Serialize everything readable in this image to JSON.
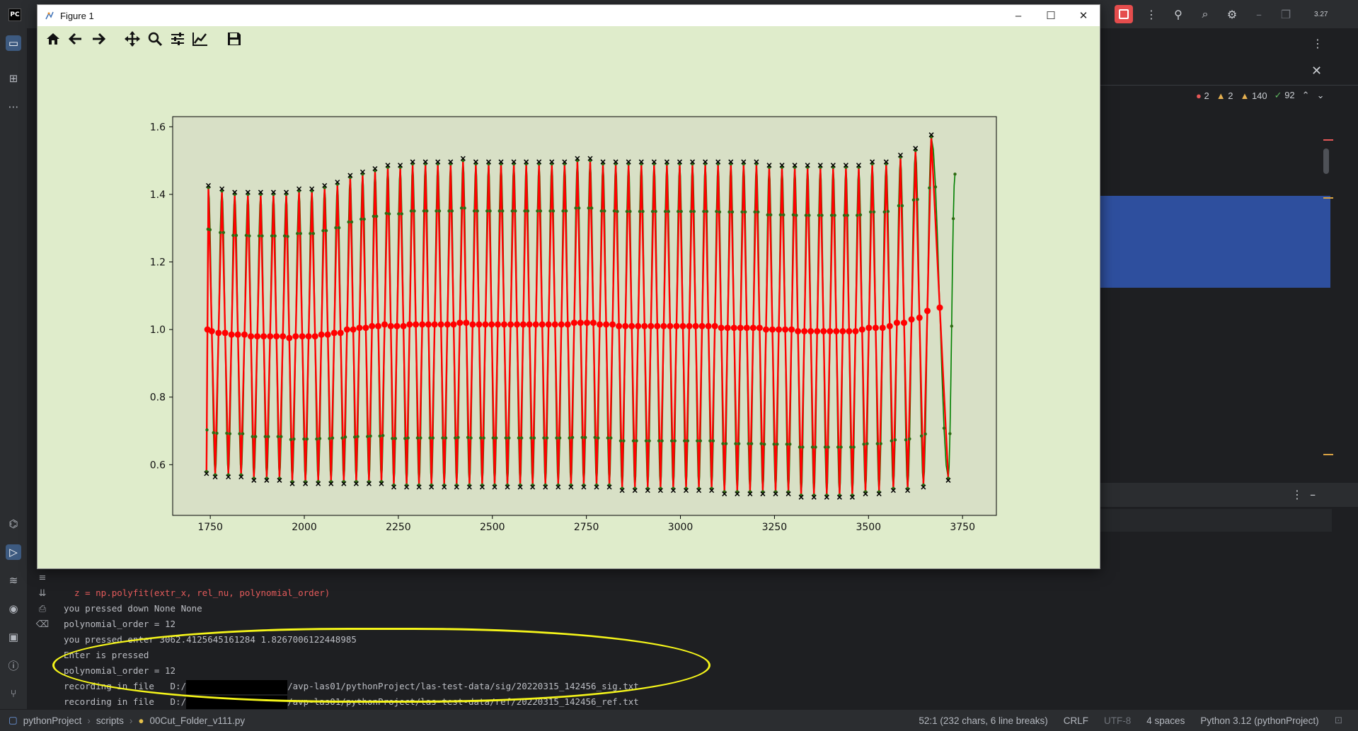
{
  "figure_window": {
    "title": "Figure 1",
    "toolbar": [
      "home-icon",
      "back-arrow-icon",
      "forward-arrow-icon",
      "pan-icon",
      "zoom-icon",
      "subplots-config-icon",
      "axes-edit-icon",
      "save-icon"
    ]
  },
  "ide": {
    "inspections": {
      "errors": "2",
      "warnings": "2",
      "weak_warnings": "140",
      "ok": "92"
    },
    "partial_label": "3.27"
  },
  "console": {
    "lines": [
      "  z = np.polyfit(extr_x, rel_nu, polynomial_order)",
      "you pressed down None None",
      "polynomial_order = 12",
      "you pressed enter 3062.4125645161284 1.8267006122448985",
      "Enter is pressed",
      "polynomial_order = 12"
    ],
    "rec1_prefix": "recording in file   D:/",
    "rec1_suffix": "/avp-las01/pythonProject/las-test-data/sig/20220315_142456_sig.txt",
    "rec2_prefix": "recording in file   D:/",
    "rec2_suffix": "/avp-las01/pythonProject/las-test-data/ref/20220315_142456_ref.txt"
  },
  "statusbar": {
    "project": "pythonProject",
    "folder": "scripts",
    "file": "00Cut_Folder_v111.py",
    "position": "52:1 (232 chars, 6 line breaks)",
    "line_sep": "CRLF",
    "encoding": "UTF-8",
    "indent": "4 spaces",
    "interpreter": "Python 3.12 (pythonProject)"
  },
  "chart_data": {
    "type": "line",
    "xlim": [
      1650,
      3840
    ],
    "ylim": [
      0.45,
      1.63
    ],
    "xticks": [
      1750,
      2000,
      2250,
      2500,
      2750,
      3000,
      3250,
      3500,
      3750
    ],
    "yticks": [
      0.6,
      0.8,
      1.0,
      1.2,
      1.4,
      1.6
    ],
    "grid": false,
    "colors": {
      "signal": "#008000",
      "fit": "#ff0000",
      "midpoint": "#ff0000",
      "extrema": "#000000"
    },
    "peaks": [
      [
        1745,
        1.42
      ],
      [
        1781,
        1.41
      ],
      [
        1815,
        1.4
      ],
      [
        1850,
        1.4
      ],
      [
        1884,
        1.4
      ],
      [
        1918,
        1.4
      ],
      [
        1952,
        1.4
      ],
      [
        1986,
        1.41
      ],
      [
        2020,
        1.41
      ],
      [
        2054,
        1.42
      ],
      [
        2088,
        1.43
      ],
      [
        2122,
        1.45
      ],
      [
        2155,
        1.46
      ],
      [
        2188,
        1.47
      ],
      [
        2222,
        1.48
      ],
      [
        2255,
        1.48
      ],
      [
        2288,
        1.49
      ],
      [
        2322,
        1.49
      ],
      [
        2355,
        1.49
      ],
      [
        2389,
        1.49
      ],
      [
        2422,
        1.5
      ],
      [
        2456,
        1.49
      ],
      [
        2490,
        1.49
      ],
      [
        2523,
        1.49
      ],
      [
        2557,
        1.49
      ],
      [
        2590,
        1.49
      ],
      [
        2624,
        1.49
      ],
      [
        2658,
        1.49
      ],
      [
        2692,
        1.49
      ],
      [
        2726,
        1.5
      ],
      [
        2760,
        1.5
      ],
      [
        2794,
        1.49
      ],
      [
        2828,
        1.49
      ],
      [
        2862,
        1.49
      ],
      [
        2896,
        1.49
      ],
      [
        2930,
        1.49
      ],
      [
        2964,
        1.49
      ],
      [
        2998,
        1.49
      ],
      [
        3032,
        1.49
      ],
      [
        3066,
        1.49
      ],
      [
        3100,
        1.49
      ],
      [
        3134,
        1.49
      ],
      [
        3168,
        1.49
      ],
      [
        3202,
        1.49
      ],
      [
        3236,
        1.48
      ],
      [
        3270,
        1.48
      ],
      [
        3304,
        1.48
      ],
      [
        3338,
        1.48
      ],
      [
        3372,
        1.48
      ],
      [
        3406,
        1.48
      ],
      [
        3440,
        1.48
      ],
      [
        3474,
        1.48
      ],
      [
        3510,
        1.49
      ],
      [
        3547,
        1.49
      ],
      [
        3585,
        1.51
      ],
      [
        3625,
        1.53
      ],
      [
        3667,
        1.57
      ]
    ],
    "troughs": [
      [
        1740,
        0.58
      ],
      [
        1763,
        0.57
      ],
      [
        1798,
        0.57
      ],
      [
        1832,
        0.57
      ],
      [
        1866,
        0.56
      ],
      [
        1900,
        0.56
      ],
      [
        1934,
        0.56
      ],
      [
        1968,
        0.55
      ],
      [
        2003,
        0.55
      ],
      [
        2037,
        0.55
      ],
      [
        2071,
        0.55
      ],
      [
        2105,
        0.55
      ],
      [
        2138,
        0.55
      ],
      [
        2172,
        0.55
      ],
      [
        2205,
        0.55
      ],
      [
        2238,
        0.54
      ],
      [
        2272,
        0.54
      ],
      [
        2305,
        0.54
      ],
      [
        2338,
        0.54
      ],
      [
        2372,
        0.54
      ],
      [
        2405,
        0.54
      ],
      [
        2439,
        0.54
      ],
      [
        2473,
        0.54
      ],
      [
        2506,
        0.54
      ],
      [
        2540,
        0.54
      ],
      [
        2574,
        0.54
      ],
      [
        2607,
        0.54
      ],
      [
        2641,
        0.54
      ],
      [
        2675,
        0.54
      ],
      [
        2709,
        0.54
      ],
      [
        2743,
        0.54
      ],
      [
        2777,
        0.54
      ],
      [
        2811,
        0.54
      ],
      [
        2845,
        0.53
      ],
      [
        2879,
        0.53
      ],
      [
        2913,
        0.53
      ],
      [
        2947,
        0.53
      ],
      [
        2981,
        0.53
      ],
      [
        3015,
        0.53
      ],
      [
        3049,
        0.53
      ],
      [
        3083,
        0.53
      ],
      [
        3117,
        0.52
      ],
      [
        3151,
        0.52
      ],
      [
        3185,
        0.52
      ],
      [
        3219,
        0.52
      ],
      [
        3253,
        0.52
      ],
      [
        3287,
        0.52
      ],
      [
        3321,
        0.51
      ],
      [
        3355,
        0.51
      ],
      [
        3389,
        0.51
      ],
      [
        3423,
        0.51
      ],
      [
        3457,
        0.51
      ],
      [
        3492,
        0.52
      ],
      [
        3528,
        0.52
      ],
      [
        3566,
        0.53
      ],
      [
        3604,
        0.53
      ],
      [
        3646,
        0.54
      ],
      [
        3712,
        0.56
      ]
    ],
    "signal_end": [
      3730,
      1.46
    ]
  }
}
